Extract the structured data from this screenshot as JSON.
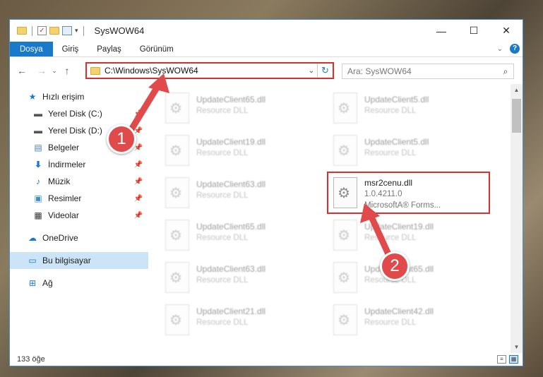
{
  "window": {
    "title": "SysWOW64",
    "controls": {
      "minimize": "—",
      "maximize": "☐",
      "close": "✕"
    }
  },
  "ribbon": {
    "tabs": [
      "Dosya",
      "Giriş",
      "Paylaş",
      "Görünüm"
    ],
    "active_tab": "Dosya",
    "help": "?"
  },
  "navigation": {
    "address": "C:\\Windows\\SysWOW64",
    "search_placeholder": "Ara: SysWOW64"
  },
  "sidebar": {
    "items": [
      {
        "label": "Hızlı erişim",
        "icon": "star-icon",
        "pinned": false
      },
      {
        "label": "Yerel Disk (C:)",
        "icon": "drive-icon",
        "pinned": true
      },
      {
        "label": "Yerel Disk (D:)",
        "icon": "drive-icon",
        "pinned": true
      },
      {
        "label": "Belgeler",
        "icon": "documents-icon",
        "pinned": true
      },
      {
        "label": "İndirmeler",
        "icon": "download-icon",
        "pinned": true
      },
      {
        "label": "Müzik",
        "icon": "music-icon",
        "pinned": true
      },
      {
        "label": "Resimler",
        "icon": "pictures-icon",
        "pinned": true
      },
      {
        "label": "Videolar",
        "icon": "video-icon",
        "pinned": true
      },
      {
        "label": "OneDrive",
        "icon": "cloud-icon",
        "pinned": false
      },
      {
        "label": "Bu bilgisayar",
        "icon": "computer-icon",
        "pinned": false,
        "selected": true
      },
      {
        "label": "Ağ",
        "icon": "network-icon",
        "pinned": false
      }
    ]
  },
  "files": {
    "left_column": [
      {
        "name": "UpdateClient65.dll",
        "desc": "Resource DLL"
      },
      {
        "name": "UpdateClient19.dll",
        "desc": "Resource DLL"
      },
      {
        "name": "UpdateClient63.dll",
        "desc": "Resource DLL"
      },
      {
        "name": "UpdateClient65.dll",
        "desc": "Resource DLL"
      },
      {
        "name": "UpdateClient63.dll",
        "desc": "Resource DLL"
      },
      {
        "name": "UpdateClient21.dll",
        "desc": "Resource DLL"
      }
    ],
    "right_column": [
      {
        "name": "UpdateClient5.dll",
        "desc": "Resource DLL"
      },
      {
        "name": "UpdateClient5.dll",
        "desc": "Resource DLL"
      },
      {
        "name": "msr2cenu.dll",
        "version": "1.0.4211.0",
        "desc": "MicrosoftA® Forms..."
      },
      {
        "name": "UpdateClient19.dll",
        "desc": "Resource DLL"
      },
      {
        "name": "UpdateClient65.dll",
        "desc": "Resource DLL"
      },
      {
        "name": "UpdateClient42.dll",
        "desc": "Resource DLL"
      }
    ]
  },
  "status": {
    "count": "133 öğe"
  },
  "callouts": [
    "1",
    "2"
  ],
  "colors": {
    "accent": "#1979ca",
    "highlight": "#d9302f",
    "callout": "#e04a4a"
  }
}
